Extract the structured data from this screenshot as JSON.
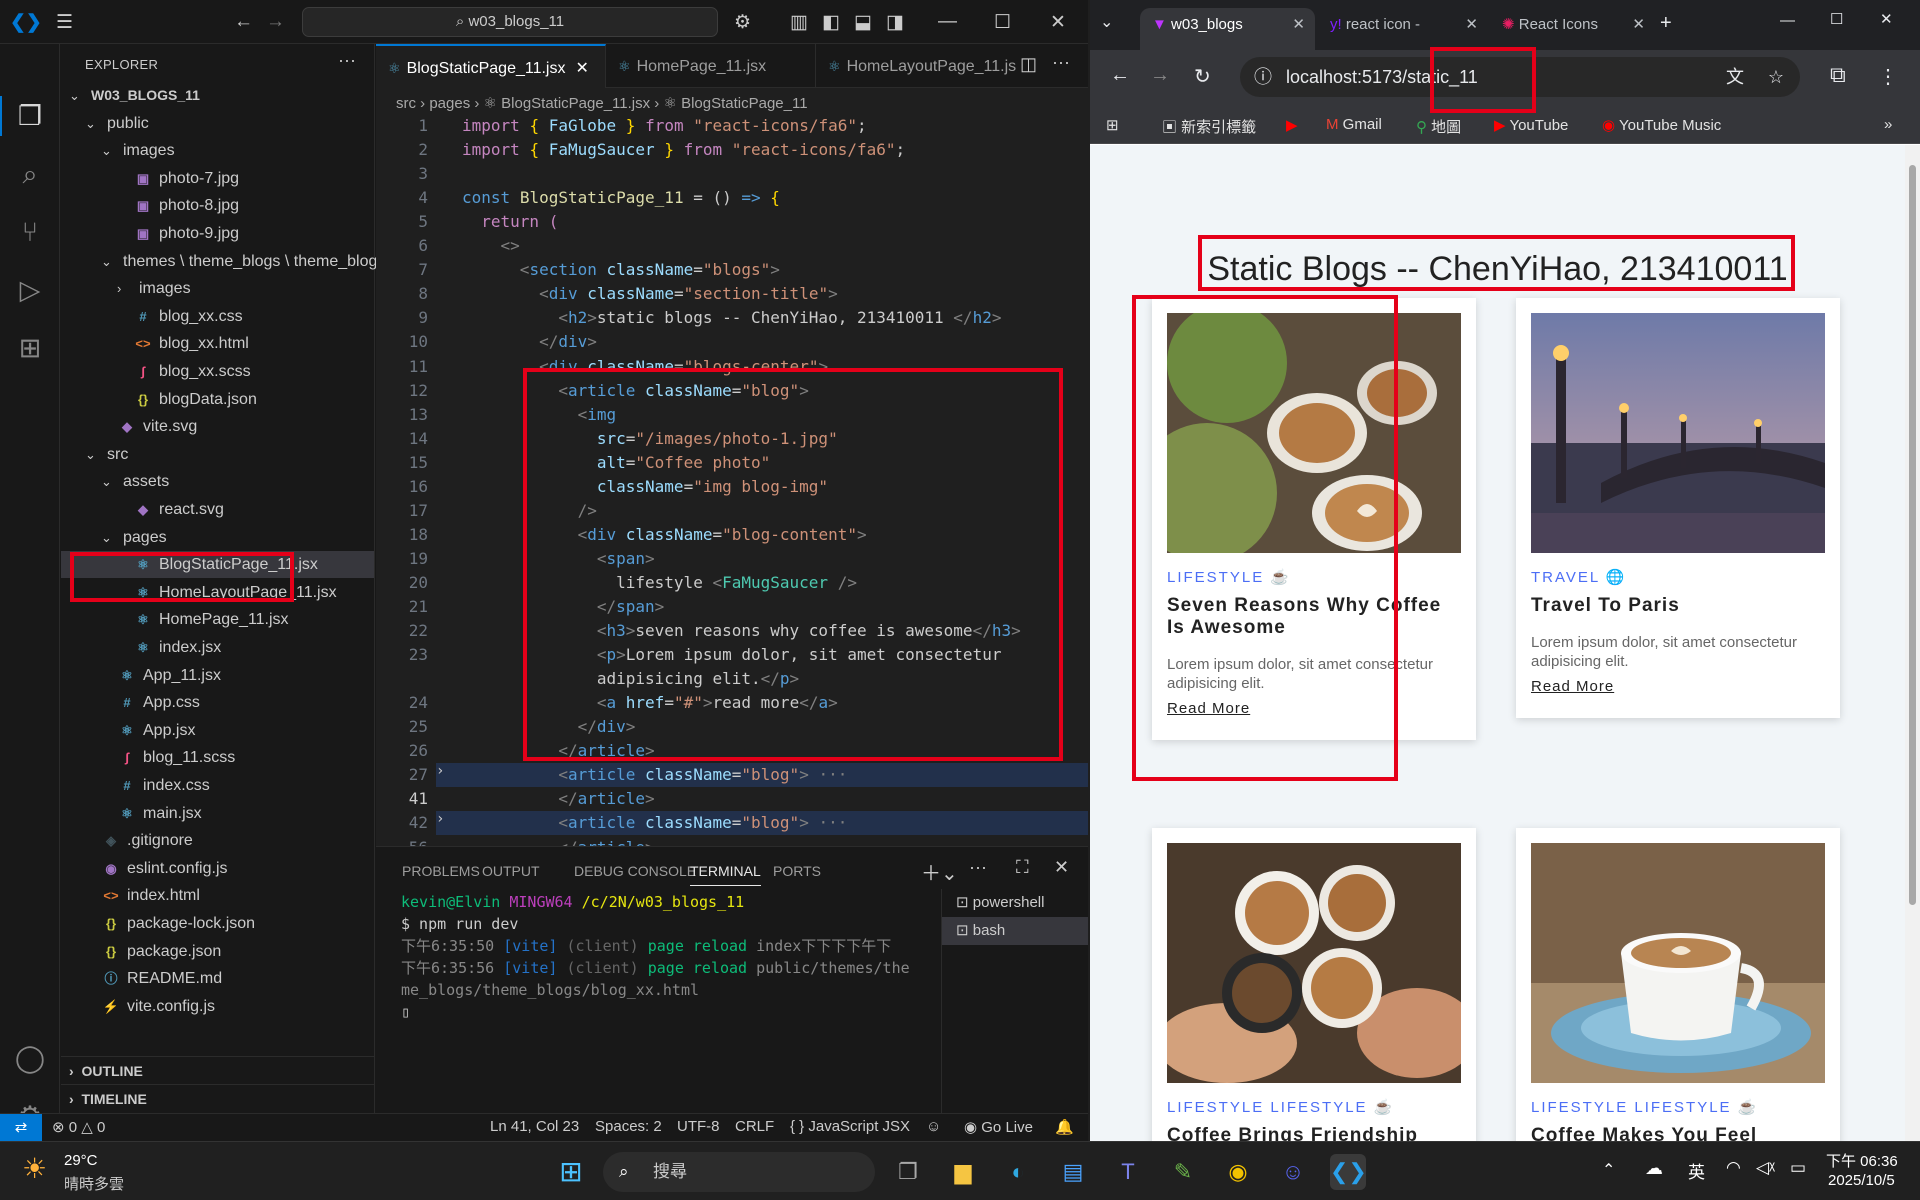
{
  "vscode": {
    "command_center": "w03_blogs_11",
    "explorer_title": "EXPLORER",
    "tree": [
      {
        "label": "W03_BLOGS_11",
        "type": "root",
        "depth": 0,
        "chev": "⌄",
        "icon": "",
        "color": "#ccc"
      },
      {
        "label": "public",
        "type": "folder",
        "depth": 1,
        "chev": "⌄",
        "icon": "",
        "color": "#ccc"
      },
      {
        "label": "images",
        "type": "folder",
        "depth": 2,
        "chev": "⌄",
        "icon": "",
        "color": "#ccc"
      },
      {
        "label": "photo-7.jpg",
        "type": "file",
        "depth": 3,
        "chev": "",
        "icon": "▣",
        "color": "#a074c4"
      },
      {
        "label": "photo-8.jpg",
        "type": "file",
        "depth": 3,
        "chev": "",
        "icon": "▣",
        "color": "#a074c4"
      },
      {
        "label": "photo-9.jpg",
        "type": "file",
        "depth": 3,
        "chev": "",
        "icon": "▣",
        "color": "#a074c4"
      },
      {
        "label": "themes \\ theme_blogs \\ theme_blogs",
        "type": "folder",
        "depth": 2,
        "chev": "⌄",
        "icon": "",
        "color": "#ccc"
      },
      {
        "label": "images",
        "type": "folder",
        "depth": 3,
        "chev": "›",
        "icon": "",
        "color": "#ccc"
      },
      {
        "label": "blog_xx.css",
        "type": "file",
        "depth": 3,
        "chev": "",
        "icon": "#",
        "color": "#519aba"
      },
      {
        "label": "blog_xx.html",
        "type": "file",
        "depth": 3,
        "chev": "",
        "icon": "<>",
        "color": "#e37933"
      },
      {
        "label": "blog_xx.scss",
        "type": "file",
        "depth": 3,
        "chev": "",
        "icon": "ʃ",
        "color": "#f55385"
      },
      {
        "label": "blogData.json",
        "type": "file",
        "depth": 3,
        "chev": "",
        "icon": "{}",
        "color": "#cbcb41"
      },
      {
        "label": "vite.svg",
        "type": "file",
        "depth": 2,
        "chev": "",
        "icon": "◆",
        "color": "#a074c4"
      },
      {
        "label": "src",
        "type": "folder",
        "depth": 1,
        "chev": "⌄",
        "icon": "",
        "color": "#ccc"
      },
      {
        "label": "assets",
        "type": "folder",
        "depth": 2,
        "chev": "⌄",
        "icon": "",
        "color": "#ccc"
      },
      {
        "label": "react.svg",
        "type": "file",
        "depth": 3,
        "chev": "",
        "icon": "◆",
        "color": "#a074c4"
      },
      {
        "label": "pages",
        "type": "folder",
        "depth": 2,
        "chev": "⌄",
        "icon": "",
        "color": "#ccc"
      },
      {
        "label": "BlogStaticPage_11.jsx",
        "type": "file",
        "depth": 3,
        "chev": "",
        "icon": "⚛",
        "color": "#519aba",
        "selected": true
      },
      {
        "label": "HomeLayoutPage_11.jsx",
        "type": "file",
        "depth": 3,
        "chev": "",
        "icon": "⚛",
        "color": "#519aba"
      },
      {
        "label": "HomePage_11.jsx",
        "type": "file",
        "depth": 3,
        "chev": "",
        "icon": "⚛",
        "color": "#519aba"
      },
      {
        "label": "index.jsx",
        "type": "file",
        "depth": 3,
        "chev": "",
        "icon": "⚛",
        "color": "#519aba"
      },
      {
        "label": "App_11.jsx",
        "type": "file",
        "depth": 2,
        "chev": "",
        "icon": "⚛",
        "color": "#519aba"
      },
      {
        "label": "App.css",
        "type": "file",
        "depth": 2,
        "chev": "",
        "icon": "#",
        "color": "#519aba"
      },
      {
        "label": "App.jsx",
        "type": "file",
        "depth": 2,
        "chev": "",
        "icon": "⚛",
        "color": "#519aba"
      },
      {
        "label": "blog_11.scss",
        "type": "file",
        "depth": 2,
        "chev": "",
        "icon": "ʃ",
        "color": "#f55385"
      },
      {
        "label": "index.css",
        "type": "file",
        "depth": 2,
        "chev": "",
        "icon": "#",
        "color": "#519aba"
      },
      {
        "label": "main.jsx",
        "type": "file",
        "depth": 2,
        "chev": "",
        "icon": "⚛",
        "color": "#519aba"
      },
      {
        "label": ".gitignore",
        "type": "file",
        "depth": 1,
        "chev": "",
        "icon": "◈",
        "color": "#41535b"
      },
      {
        "label": "eslint.config.js",
        "type": "file",
        "depth": 1,
        "chev": "",
        "icon": "◉",
        "color": "#a074c4"
      },
      {
        "label": "index.html",
        "type": "file",
        "depth": 1,
        "chev": "",
        "icon": "<>",
        "color": "#e37933"
      },
      {
        "label": "package-lock.json",
        "type": "file",
        "depth": 1,
        "chev": "",
        "icon": "{}",
        "color": "#cbcb41"
      },
      {
        "label": "package.json",
        "type": "file",
        "depth": 1,
        "chev": "",
        "icon": "{}",
        "color": "#cbcb41"
      },
      {
        "label": "README.md",
        "type": "file",
        "depth": 1,
        "chev": "",
        "icon": "ⓘ",
        "color": "#519aba"
      },
      {
        "label": "vite.config.js",
        "type": "file",
        "depth": 1,
        "chev": "",
        "icon": "⚡",
        "color": "#cbcb41"
      }
    ],
    "outline_label": "OUTLINE",
    "timeline_label": "TIMELINE",
    "tabs": [
      {
        "label": "BlogStaticPage_11.jsx",
        "active": true
      },
      {
        "label": "HomePage_11.jsx",
        "active": false
      },
      {
        "label": "HomeLayoutPage_11.js",
        "active": false
      }
    ],
    "breadcrumb": "src  ›  pages  ›  ⚛ BlogStaticPage_11.jsx  ›  ⚛ BlogStaticPage_11",
    "code_lines": [
      {
        "n": "1",
        "html": "<span class='k'>import</span> <span class='y'>{</span> <span class='v'>FaGlobe</span> <span class='y'>}</span> <span class='k'>from</span> <span class='s'>\"react-icons/fa6\"</span>;"
      },
      {
        "n": "2",
        "html": "<span class='k'>import</span> <span class='y'>{</span> <span class='v'>FaMugSaucer</span> <span class='y'>}</span> <span class='k'>from</span> <span class='s'>\"react-icons/fa6\"</span>;"
      },
      {
        "n": "3",
        "html": ""
      },
      {
        "n": "4",
        "html": "<span class='kw'>const</span> <span class='f'>BlogStaticPage_11</span> = () <span class='kw'>=&gt;</span> <span class='y'>{</span>"
      },
      {
        "n": "5",
        "html": "  <span class='k'>return</span> <span class='k'>(</span>"
      },
      {
        "n": "6",
        "html": "    <span class='p'>&lt;&gt;</span>"
      },
      {
        "n": "7",
        "html": "      <span class='p'>&lt;</span><span class='t'>section</span> <span class='a'>className</span>=<span class='s'>\"blogs\"</span><span class='p'>&gt;</span>"
      },
      {
        "n": "8",
        "html": "        <span class='p'>&lt;</span><span class='t'>div</span> <span class='a'>className</span>=<span class='s'>\"section-title\"</span><span class='p'>&gt;</span>"
      },
      {
        "n": "9",
        "html": "          <span class='p'>&lt;</span><span class='t'>h2</span><span class='p'>&gt;</span>static blogs -- ChenYiHao, 213410011 <span class='p'>&lt;/</span><span class='t'>h2</span><span class='p'>&gt;</span>"
      },
      {
        "n": "10",
        "html": "        <span class='p'>&lt;/</span><span class='t'>div</span><span class='p'>&gt;</span>"
      },
      {
        "n": "11",
        "html": "        <span class='p'>&lt;</span><span class='t'>div</span> <span class='a'>className</span>=<span class='s'>\"blogs-center\"</span><span class='p'>&gt;</span>"
      },
      {
        "n": "12",
        "html": "          <span class='p'>&lt;</span><span class='t'>article</span> <span class='a'>className</span>=<span class='s'>\"blog\"</span><span class='p'>&gt;</span>"
      },
      {
        "n": "13",
        "html": "            <span class='p'>&lt;</span><span class='t'>img</span>"
      },
      {
        "n": "14",
        "html": "              <span class='a'>src</span>=<span class='s'>\"/images/photo-1.jpg\"</span>"
      },
      {
        "n": "15",
        "html": "              <span class='a'>alt</span>=<span class='s'>\"Coffee photo\"</span>"
      },
      {
        "n": "16",
        "html": "              <span class='a'>className</span>=<span class='s'>\"img blog-img\"</span>"
      },
      {
        "n": "17",
        "html": "            <span class='p'>/&gt;</span>"
      },
      {
        "n": "18",
        "html": "            <span class='p'>&lt;</span><span class='t'>div</span> <span class='a'>className</span>=<span class='s'>\"blog-content\"</span><span class='p'>&gt;</span>"
      },
      {
        "n": "19",
        "html": "              <span class='p'>&lt;</span><span class='t'>span</span><span class='p'>&gt;</span>"
      },
      {
        "n": "20",
        "html": "                lifestyle <span class='p'>&lt;</span><span class='c'>FaMugSaucer</span> <span class='p'>/&gt;</span>"
      },
      {
        "n": "21",
        "html": "              <span class='p'>&lt;/</span><span class='t'>span</span><span class='p'>&gt;</span>"
      },
      {
        "n": "22",
        "html": "              <span class='p'>&lt;</span><span class='t'>h3</span><span class='p'>&gt;</span>seven reasons why coffee is awesome<span class='p'>&lt;/</span><span class='t'>h3</span><span class='p'>&gt;</span>"
      },
      {
        "n": "23",
        "html": "              <span class='p'>&lt;</span><span class='t'>p</span><span class='p'>&gt;</span>Lorem ipsum dolor, sit amet consectetur"
      },
      {
        "n": "",
        "html": "              adipisicing elit.<span class='p'>&lt;/</span><span class='t'>p</span><span class='p'>&gt;</span>"
      },
      {
        "n": "24",
        "html": "              <span class='p'>&lt;</span><span class='t'>a</span> <span class='a'>href</span>=<span class='s'>\"#\"</span><span class='p'>&gt;</span>read more<span class='p'>&lt;/</span><span class='t'>a</span><span class='p'>&gt;</span>"
      },
      {
        "n": "25",
        "html": "            <span class='p'>&lt;/</span><span class='t'>div</span><span class='p'>&gt;</span>"
      },
      {
        "n": "26",
        "html": "          <span class='p'>&lt;/</span><span class='t'>article</span><span class='p'>&gt;</span>"
      },
      {
        "n": "27",
        "html": "          <span class='p'>&lt;</span><span class='t'>article</span> <span class='a'>className</span>=<span class='s'>\"blog\"</span><span class='p'>&gt;</span> <span class='p'>···</span>",
        "hl": true
      },
      {
        "n": "41",
        "html": "          <span class='p'>&lt;/</span><span class='t'>article</span><span class='p'>&gt;</span>",
        "cur": true
      },
      {
        "n": "42",
        "html": "          <span class='p'>&lt;</span><span class='t'>article</span> <span class='a'>className</span>=<span class='s'>\"blog\"</span><span class='p'>&gt;</span> <span class='p'>···</span>",
        "hl": true
      },
      {
        "n": "56",
        "html": "          <span class='p'>&lt;/</span><span class='t'>article</span><span class='p'>&gt;</span>"
      }
    ],
    "panel_tabs": [
      "PROBLEMS",
      "OUTPUT",
      "DEBUG CONSOLE",
      "TERMINAL",
      "PORTS"
    ],
    "terminal_html": "<span style='color:#0dbc79'>kevin@Elvin</span> <span style='color:#bc3fbc'>MINGW64</span> <span style='color:#e5e510'>/c/2N/w03_blogs_11</span>\n$ npm run dev\n<span style='color:#888'>下午6:35:50</span> <span style='color:#2472c8'>[vite]</span> <span style='color:#666'>(client)</span> <span style='color:#0dbc79'>page reload</span> <span style='color:#888'>index下下下下午下</span>\n<span style='color:#888'>下午6:35:56</span> <span style='color:#2472c8'>[vite]</span> <span style='color:#666'>(client)</span> <span style='color:#0dbc79'>page reload</span> <span style='color:#888'>public/themes/the</span>\n<span style='color:#888'>me_blogs/theme_blogs/blog_xx.html</span>\n▯",
    "terminals": [
      "powershell",
      "bash"
    ],
    "status": {
      "problems": "⊗ 0 △ 0",
      "position": "Ln 41, Col 23",
      "spaces": "Spaces: 2",
      "encoding": "UTF-8",
      "eol": "CRLF",
      "language": "{ } JavaScript JSX",
      "golive": "Go Live"
    }
  },
  "chrome": {
    "tabs": [
      {
        "label": "w03_blogs",
        "active": true,
        "icon": "▼",
        "color": "#bd34fe"
      },
      {
        "label": "react icon -",
        "active": false,
        "icon": "y!",
        "color": "#7e1fff"
      },
      {
        "label": "React Icons",
        "active": false,
        "icon": "✺",
        "color": "#e91e63"
      }
    ],
    "url": "localhost:5173/static_11",
    "bookmarks": [
      "新索引標籤",
      "Gmail",
      "地圖",
      "YouTube",
      "YouTube Music"
    ],
    "page_title": "Static Blogs -- ChenYiHao, 213410011",
    "cards": [
      {
        "category": "LIFESTYLE ☕",
        "title": "Seven Reasons Why Coffee Is Awesome",
        "desc": "Lorem ipsum dolor, sit amet consectetur adipisicing elit.",
        "more": "Read More"
      },
      {
        "category": "TRAVEL 🌐",
        "title": "Travel To Paris",
        "desc": "Lorem ipsum dolor, sit amet consectetur adipisicing elit.",
        "more": "Read More"
      },
      {
        "category": "LIFESTYLE LIFESTYLE ☕",
        "title": "Coffee Brings Friendship",
        "desc": "",
        "more": ""
      },
      {
        "category": "LIFESTYLE LIFESTYLE ☕",
        "title": "Coffee Makes You Feel",
        "desc": "",
        "more": ""
      }
    ]
  },
  "taskbar": {
    "temp": "29°C",
    "weather": "晴時多雲",
    "search_placeholder": "搜尋",
    "ime": "英",
    "time": "下午 06:36",
    "date": "2025/10/5"
  },
  "colors": {
    "accent": "#0078d4",
    "annotation_red": "#e50019",
    "link_blue": "#4c6ef5"
  }
}
